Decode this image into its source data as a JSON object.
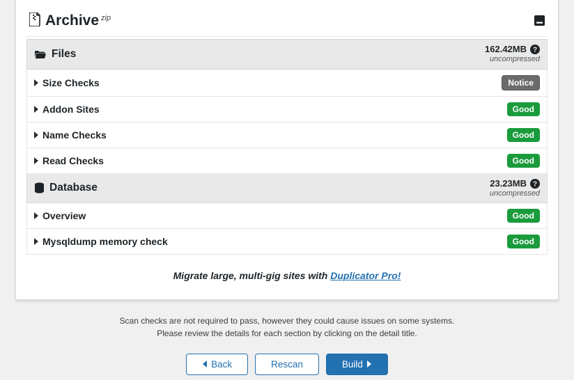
{
  "header": {
    "title": "Archive",
    "suffix": "zip"
  },
  "sections": {
    "files": {
      "title": "Files",
      "size": "162.42MB",
      "sub": "uncompressed"
    },
    "database": {
      "title": "Database",
      "size": "23.23MB",
      "sub": "uncompressed"
    }
  },
  "checks": {
    "size": {
      "label": "Size Checks",
      "status": "Notice"
    },
    "addon": {
      "label": "Addon Sites",
      "status": "Good"
    },
    "name": {
      "label": "Name Checks",
      "status": "Good"
    },
    "read": {
      "label": "Read Checks",
      "status": "Good"
    },
    "overview": {
      "label": "Overview",
      "status": "Good"
    },
    "mysqldump": {
      "label": "Mysqldump memory check",
      "status": "Good"
    }
  },
  "promo": {
    "prefix": "Migrate large, multi-gig sites with ",
    "link": "Duplicator Pro!"
  },
  "footer": {
    "line1": "Scan checks are not required to pass, however they could cause issues on some systems.",
    "line2": "Please review the details for each section by clicking on the detail title."
  },
  "buttons": {
    "back": "Back",
    "rescan": "Rescan",
    "build": "Build"
  }
}
